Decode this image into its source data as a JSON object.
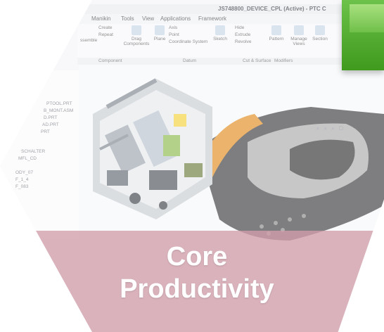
{
  "window": {
    "title": "JS748800_DEVICE_CPL (Active) - PTC C"
  },
  "menu": [
    "Manikin",
    "Tools",
    "View",
    "Applications",
    "Framework"
  ],
  "ribbon": {
    "create": "Create",
    "repeat": "Repeat",
    "assemble": "ssemble",
    "drag_components": "Drag\nComponents",
    "plane": "Plane",
    "axis": "Axis",
    "point": "Point",
    "coordinate_system": "Coordinate System",
    "sketch": "Sketch",
    "hide": "Hide",
    "extrude": "Extrude",
    "revolve": "Revolve",
    "pattern": "Pattern",
    "manage_views": "Manage\nViews",
    "section": "Section"
  },
  "groups": {
    "component": "Component",
    "datum": "Datum",
    "cut_surface": "Cut & Surface",
    "modifiers": "Modifiers"
  },
  "tree_items": [
    "PTOOL.PRT",
    "B_MONT.ASM",
    "D.PRT",
    "AD.PRT",
    "PRT",
    "SCHALTER",
    "MFL_CD",
    "ODY_07",
    "F_1_4",
    "F_083"
  ],
  "badge_text": [
    "Core",
    "Productivity"
  ],
  "colors": {
    "accent_green": "#5cb335",
    "band": "#ba6a7e"
  }
}
